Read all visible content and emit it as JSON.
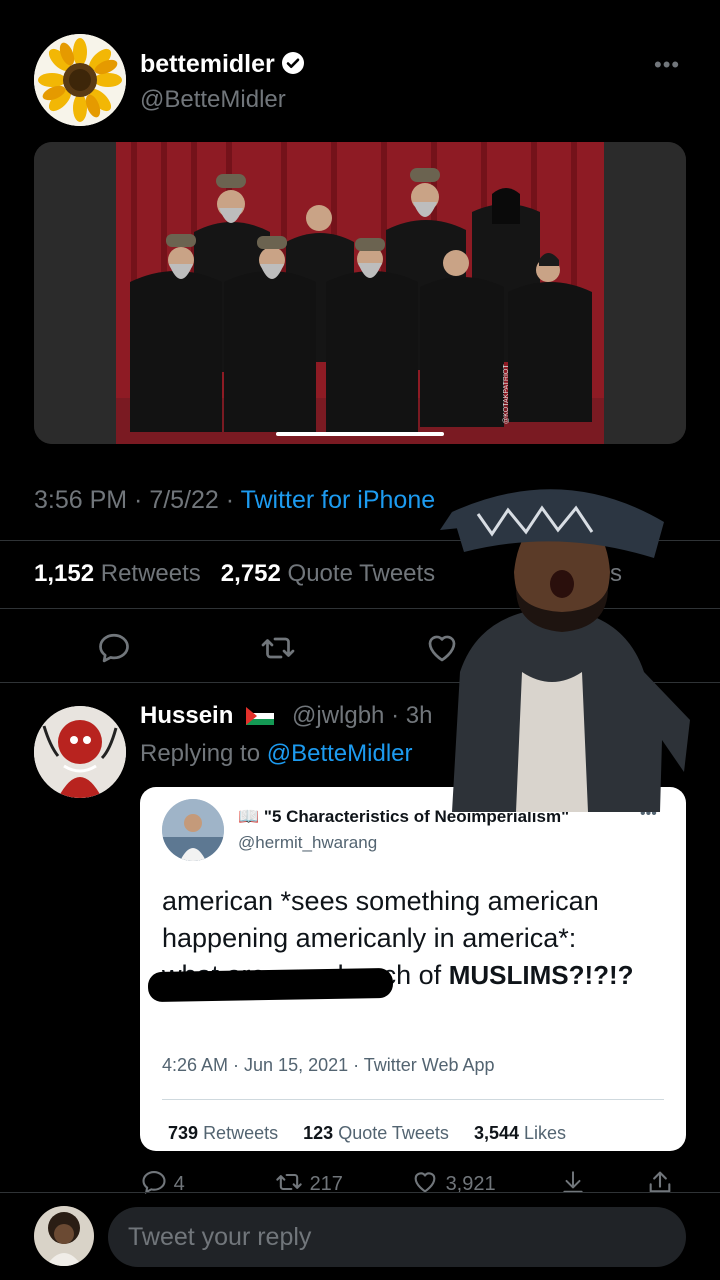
{
  "tweet": {
    "display_name": "bettemidler",
    "handle": "@BetteMidler",
    "more_label": "•••",
    "time": "3:56 PM · 7/5/22 · ",
    "source": "Twitter for iPhone",
    "retweets_count": "1,152",
    "retweets_label": "Retweets",
    "quotes_count": "2,752",
    "quotes_label": "Quote Tweets",
    "likes_label": "Likes",
    "media_watermark": "@KOTAKPATRIOT"
  },
  "icons": {
    "verified": "verified-badge-icon",
    "reply": "reply-icon",
    "retweet": "retweet-icon",
    "like": "heart-icon",
    "share": "share-icon",
    "bookmark": "bookmark-icon"
  },
  "reply": {
    "display_name": "Hussein",
    "flag": "palestine-flag",
    "handle_time": "@jwlgbh · 3h",
    "replying_prefix": "Replying to ",
    "replying_to": "@BetteMidler",
    "reply_count": "4",
    "retweet_count": "217",
    "like_count": "3,921"
  },
  "embedded_tweet": {
    "display_name": "📖 \"5 Characteristics of Neoimperialism\"",
    "handle": "@hermit_hwarang",
    "more_label": "•••",
    "text_line1": "american *sees something american",
    "text_line2": "happening americanly in america*:",
    "text_line3": "what are we a bunch of ",
    "text_bold": "MUSLIMS?!?!?",
    "time": "4:26 AM · Jun 15, 2021 · Twitter Web App",
    "retweets_count": "739",
    "retweets_label": "Retweets",
    "quotes_count": "123",
    "quotes_label": "Quote Tweets",
    "likes_count": "3,544",
    "likes_label": "Likes"
  },
  "composer": {
    "placeholder": "Tweet your reply"
  },
  "colors": {
    "background": "#000000",
    "accent": "#1d9bf0",
    "muted": "#71767b",
    "curtain": "#8e1b24"
  }
}
